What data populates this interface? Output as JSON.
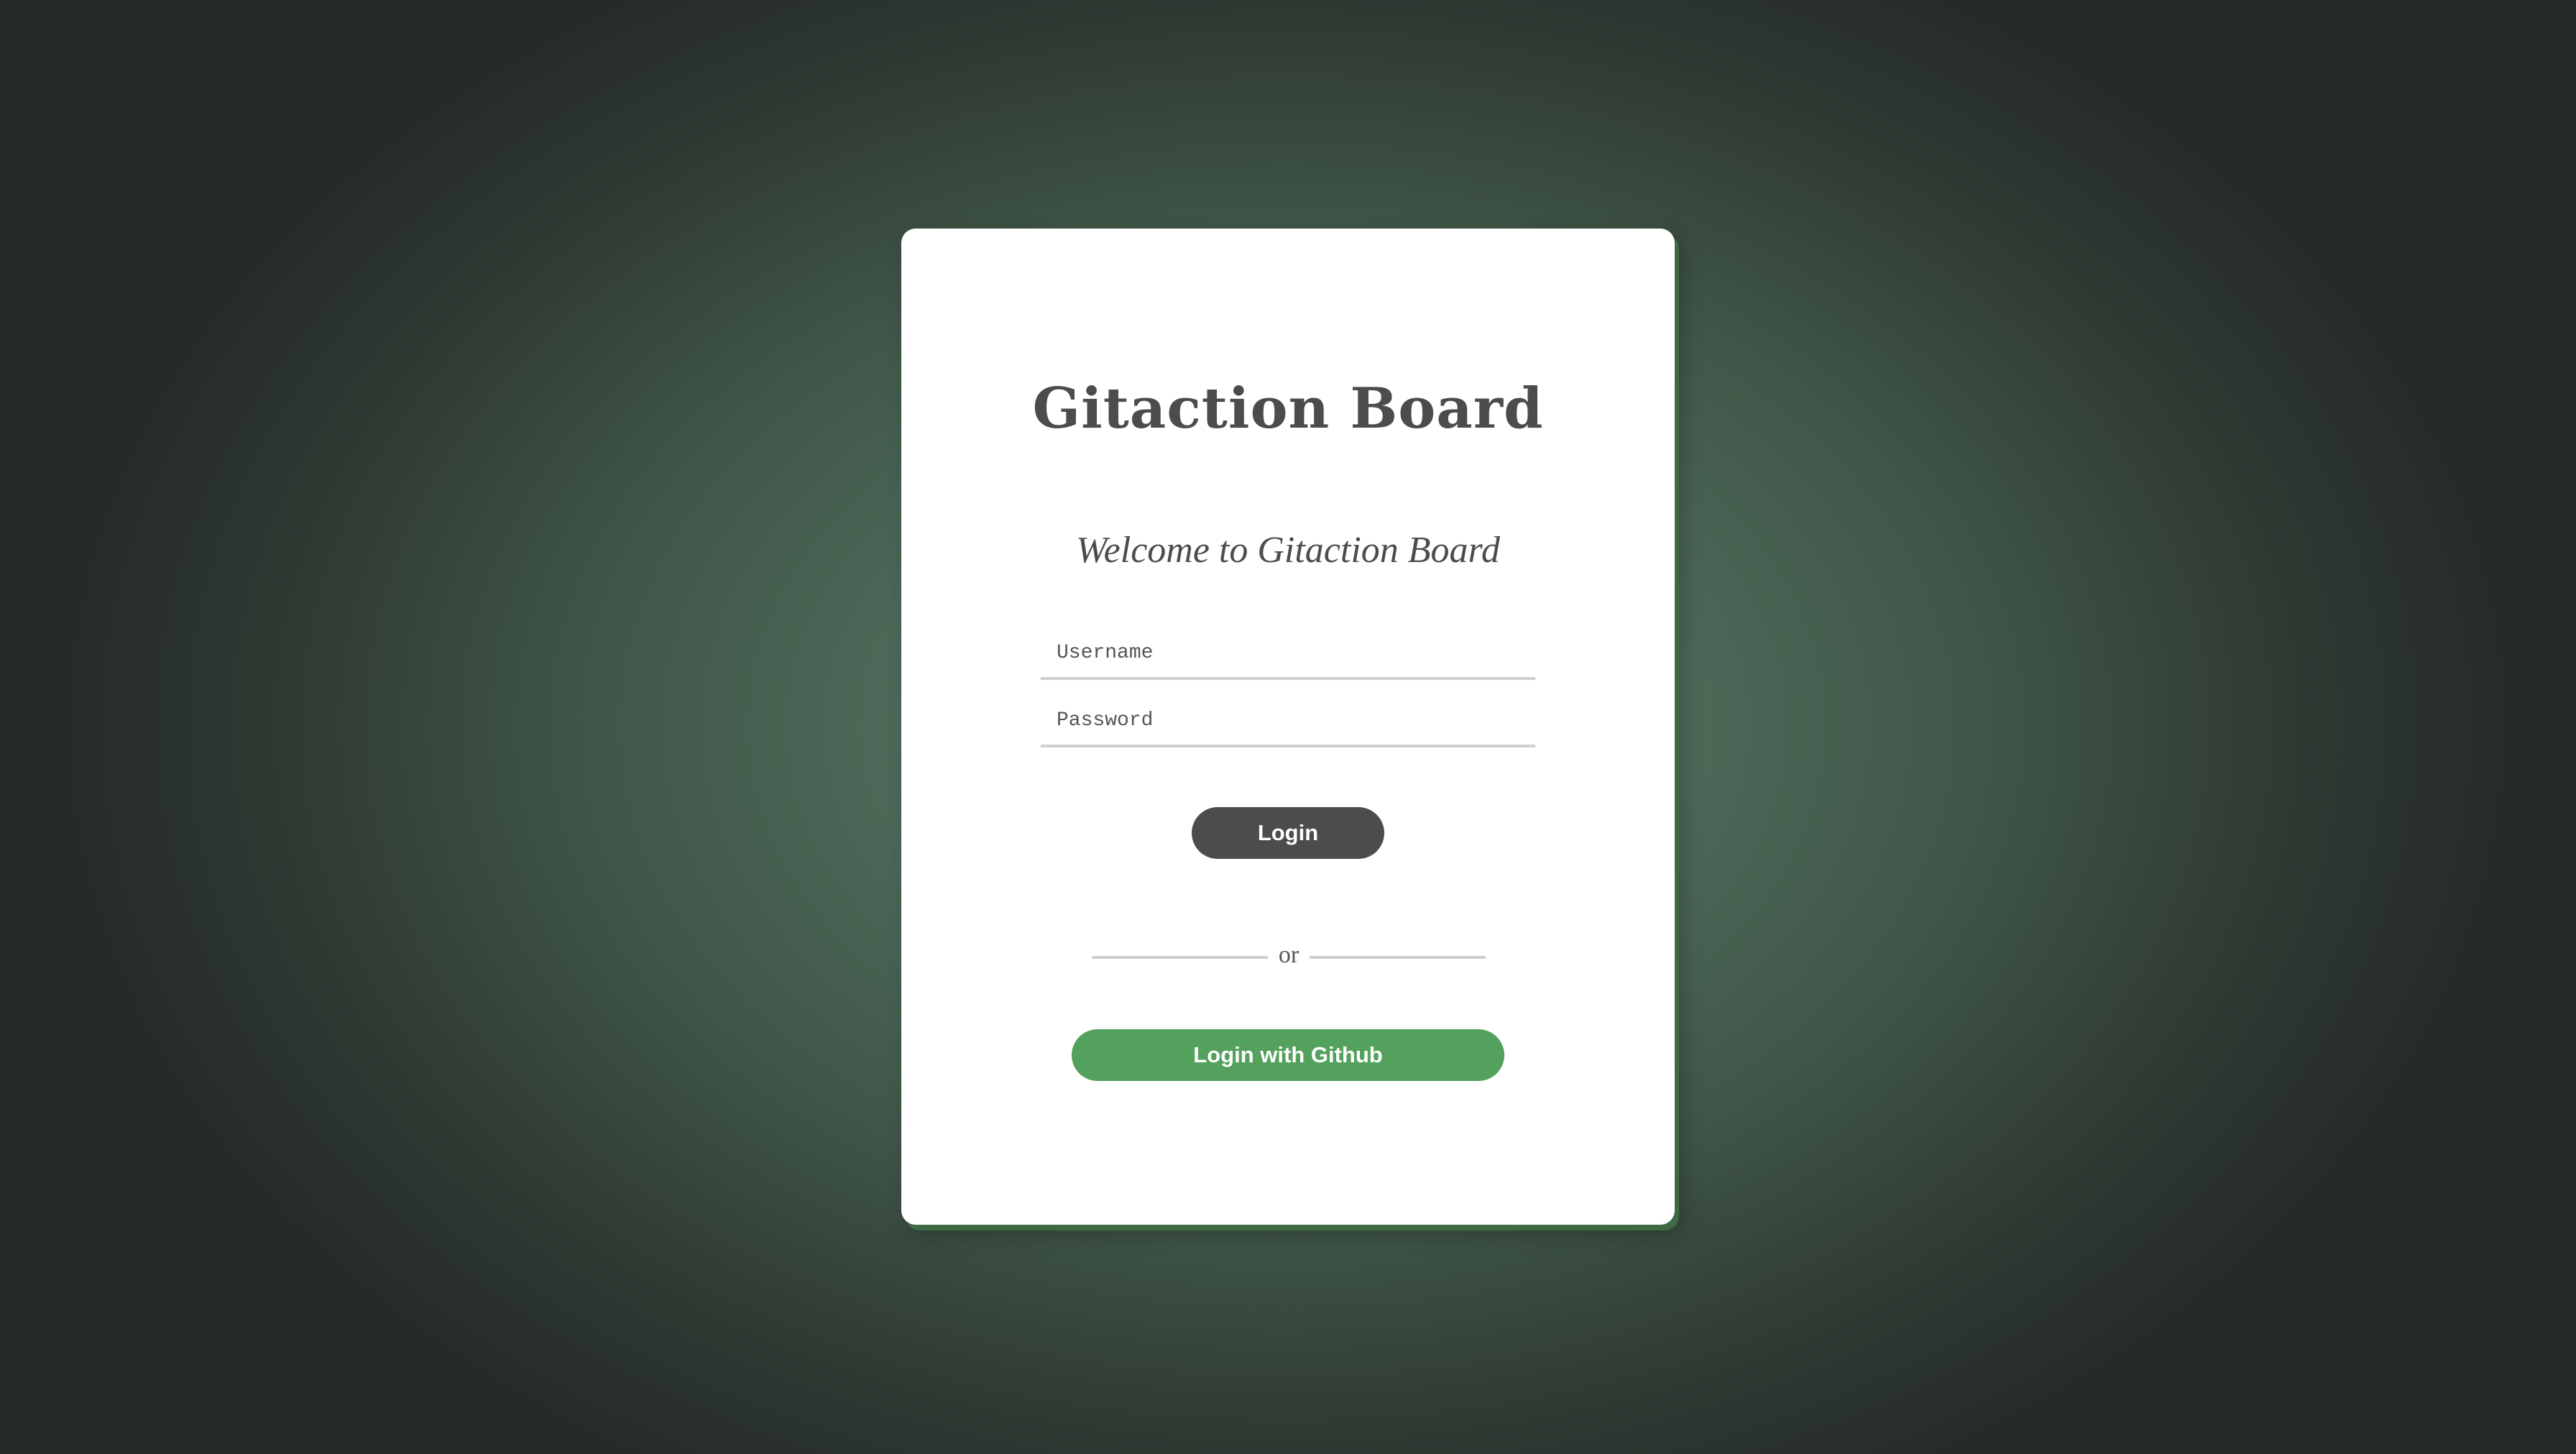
{
  "login_card": {
    "title": "Gitaction Board",
    "subtitle": "Welcome to Gitaction Board",
    "username": {
      "value": "",
      "placeholder": "Username"
    },
    "password": {
      "value": "",
      "placeholder": "Password"
    },
    "login_label": "Login",
    "divider_text": "or",
    "github_login_label": "Login with Github"
  },
  "colors": {
    "background_center": "#5b7c6a",
    "background_edge": "#262b28",
    "card": "#ffffff",
    "card_shadow": "#3f6a44",
    "text_dark": "#4e4b4c",
    "login_button": "#4e4b4c",
    "github_button": "#53a15c",
    "input_underline": "#cfcfcf"
  }
}
